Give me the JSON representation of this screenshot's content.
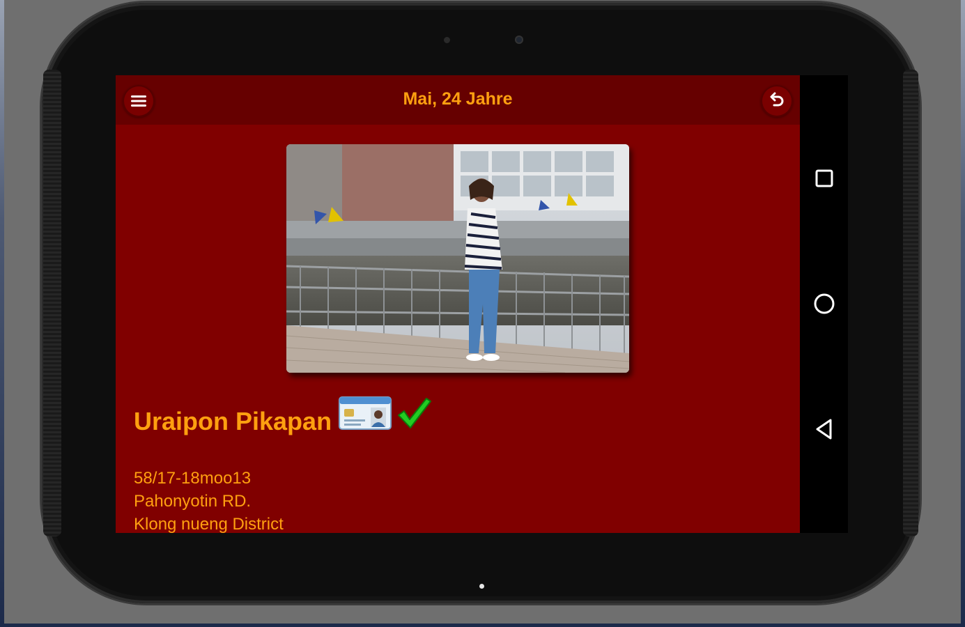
{
  "app": {
    "title": "Mai, 24 Jahre"
  },
  "toolbar": {
    "menu_icon": "hamburger-menu-icon",
    "back_icon": "undo-back-icon"
  },
  "profile": {
    "photo_icon": "profile-photo",
    "name": "Uraipon Pikapan",
    "verified_icon": "id-card-icon",
    "check_icon": "green-check-icon",
    "address": {
      "line1": "58/17-18moo13",
      "line2": "Pahonyotin RD.",
      "line3": "Klong nueng District"
    }
  },
  "android_nav": {
    "recents_icon": "square-recents-icon",
    "home_icon": "circle-home-icon",
    "back_icon": "triangle-back-icon"
  },
  "colors": {
    "screen_bg": "#800000",
    "toolbar_bg": "#660000",
    "accent_text": "#ffa010",
    "check_green": "#22cc22"
  }
}
